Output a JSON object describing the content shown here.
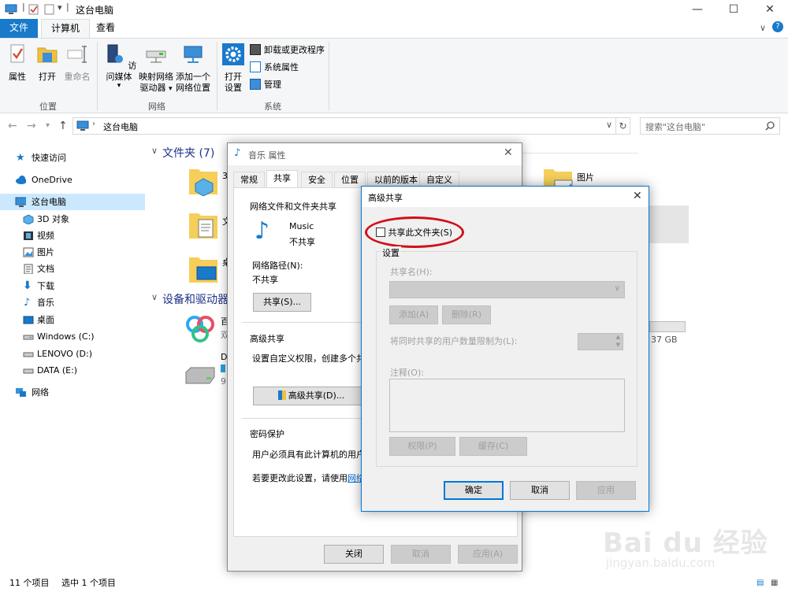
{
  "window": {
    "title": "这台电脑",
    "minimize": "—",
    "maximize": "☐",
    "close": "✕"
  },
  "ribbon": {
    "tabs": [
      "文件",
      "计算机",
      "查看"
    ],
    "expand": "∨",
    "help": "?",
    "groups": {
      "location": {
        "label": "位置",
        "items": [
          "属性",
          "打开",
          "重命名"
        ]
      },
      "network": {
        "label": "网络",
        "access_media": "访问媒体",
        "map_drive_l1": "映射网络",
        "map_drive_l2": "驱动器",
        "add_loc_l1": "添加一个",
        "add_loc_l2": "网络位置"
      },
      "system": {
        "label": "系统",
        "open_settings_l1": "打开",
        "open_settings_l2": "设置",
        "uninstall": "卸载或更改程序",
        "sysprops": "系统属性",
        "manage": "管理"
      }
    }
  },
  "address": {
    "path": "这台电脑",
    "search_placeholder": "搜索\"这台电脑\""
  },
  "nav_pane": {
    "items": [
      {
        "label": "快速访问"
      },
      {
        "label": "OneDrive"
      },
      {
        "label": "这台电脑"
      },
      {
        "label": "3D 对象"
      },
      {
        "label": "视频"
      },
      {
        "label": "图片"
      },
      {
        "label": "文档"
      },
      {
        "label": "下载"
      },
      {
        "label": "音乐"
      },
      {
        "label": "桌面"
      },
      {
        "label": "Windows (C:)"
      },
      {
        "label": "LENOVO (D:)"
      },
      {
        "label": "DATA (E:)"
      },
      {
        "label": "网络"
      }
    ]
  },
  "content": {
    "folders_header": "文件夹 (7)",
    "devices_header": "设备和驱动器",
    "pictures_label": "图片",
    "item_3": "3",
    "item_wen": "文",
    "item_zhuo": "桌",
    "item_bai": "百",
    "item_shuang": "双",
    "item_d": "D",
    "item_9": "9",
    "drive_size": "37 GB"
  },
  "status": {
    "count": "11 个项目",
    "selected": "选中 1 个项目"
  },
  "properties": {
    "title": "音乐 属性",
    "tabs": [
      "常规",
      "共享",
      "安全",
      "位置",
      "以前的版本",
      "自定义"
    ],
    "net_share_heading": "网络文件和文件夹共享",
    "folder_name": "Music",
    "folder_state": "不共享",
    "net_path_label": "网络路径(N):",
    "net_path_value": "不共享",
    "share_button": "共享(S)...",
    "adv_heading": "高级共享",
    "adv_desc": "设置自定义权限，创建多个共",
    "adv_button": "高级共享(D)...",
    "pwd_heading": "密码保护",
    "pwd_desc": "用户必须具有此计算机的用户",
    "pwd_change_prefix": "若要更改此设置，请使用",
    "pwd_change_link": "网络",
    "close_button": "关闭",
    "cancel_button": "取消",
    "apply_button": "应用(A)"
  },
  "advanced": {
    "title": "高级共享",
    "share_checkbox": "共享此文件夹(S)",
    "settings_label": "设置",
    "share_name_label": "共享名(H):",
    "add_button": "添加(A)",
    "remove_button": "删除(R)",
    "limit_label": "将同时共享的用户数量限制为(L):",
    "comment_label": "注释(O):",
    "permissions_button": "权限(P)",
    "caching_button": "缓存(C)",
    "ok_button": "确定",
    "cancel_button": "取消",
    "apply_button": "应用"
  },
  "watermark": {
    "brand": "Bai du 经验",
    "url": "jingyan.baidu.com"
  },
  "colors": {
    "accent": "#0078d7",
    "file_tab": "#1979ca",
    "selection": "#cce8ff",
    "annotation": "#d0101a"
  }
}
